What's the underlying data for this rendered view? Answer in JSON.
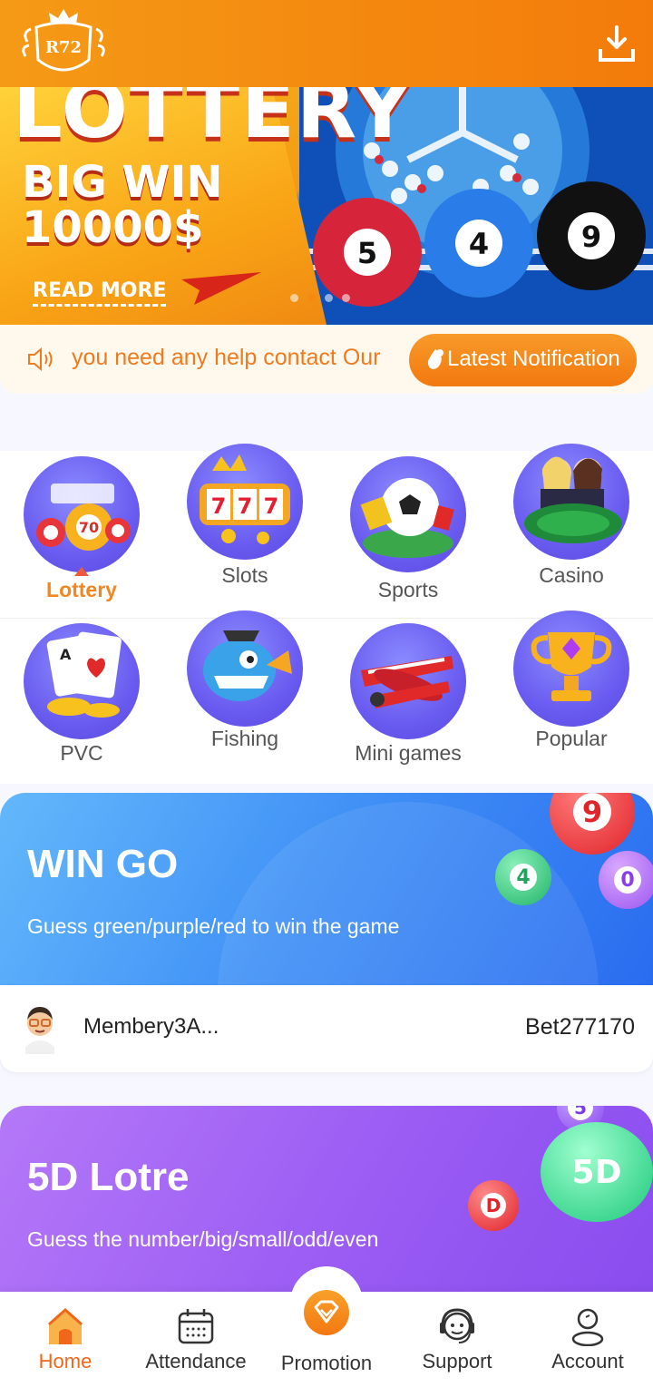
{
  "header": {
    "logo_text": "R72",
    "download_icon": "download-icon"
  },
  "banner": {
    "title": "LOTTERY",
    "big_win": "BIG WIN",
    "amount": "10000$",
    "read_more": "READ MORE",
    "ball_numbers": [
      "5",
      "4",
      "9"
    ]
  },
  "notice": {
    "icon": "speaker-icon",
    "text": "you need any help contact Our",
    "button_label": "Latest Notification"
  },
  "categories": [
    {
      "label": "Lottery",
      "active": true
    },
    {
      "label": "Slots",
      "active": false
    },
    {
      "label": "Sports",
      "active": false
    },
    {
      "label": "Casino",
      "active": false
    },
    {
      "label": "PVC",
      "active": false
    },
    {
      "label": "Fishing",
      "active": false
    },
    {
      "label": "Mini games",
      "active": false
    },
    {
      "label": "Popular",
      "active": false
    }
  ],
  "wingo": {
    "title": "WIN GO",
    "subtitle": "Guess green/purple/red to win the game",
    "ball_numbers": [
      "9",
      "4",
      "0"
    ]
  },
  "winner": {
    "name": "Membery3A...",
    "bet": "Bet277170"
  },
  "lotre": {
    "title": "5D Lotre",
    "subtitle": "Guess the number/big/small/odd/even",
    "ball_labels": [
      "5",
      "5D",
      "D"
    ]
  },
  "nav": {
    "items": [
      {
        "label": "Home",
        "icon": "home-icon",
        "active": true
      },
      {
        "label": "Attendance",
        "icon": "calendar-icon",
        "active": false
      },
      {
        "label": "Promotion",
        "icon": "diamond-icon",
        "active": false
      },
      {
        "label": "Support",
        "icon": "headset-icon",
        "active": false
      },
      {
        "label": "Account",
        "icon": "user-icon",
        "active": false
      }
    ]
  },
  "colors": {
    "brand_orange": "#f37b0a",
    "wingo_blue": "#3f8ff6",
    "lotre_purple": "#9a5cf3",
    "active_nav": "#f0661a"
  }
}
